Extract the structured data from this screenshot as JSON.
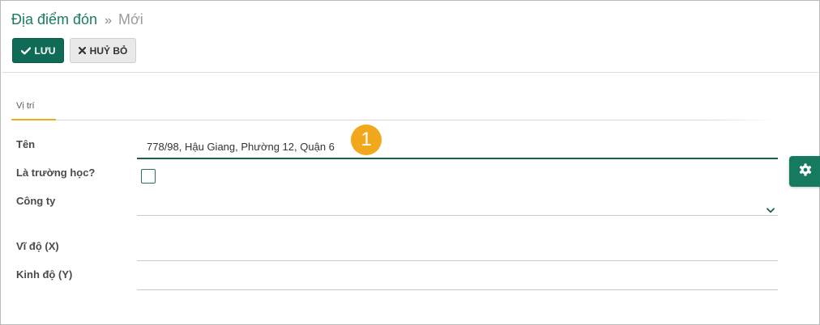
{
  "breadcrumb": {
    "parent": "Địa điểm đón",
    "separator": "»",
    "current": "Mới"
  },
  "toolbar": {
    "save_label": "LƯU",
    "cancel_label": "HUỶ BỎ"
  },
  "tabs": [
    {
      "label": "Vị trí",
      "active": true
    }
  ],
  "form": {
    "name_label": "Tên",
    "name_value": "778/98, Hậu Giang, Phường 12, Quận 6",
    "school_label": "Là trường học?",
    "school_checked": false,
    "company_label": "Công ty",
    "company_value": "",
    "lat_label": "Vĩ độ (X)",
    "lat_value": "",
    "lng_label": "Kinh độ (Y)",
    "lng_value": ""
  },
  "annotation": {
    "step": "1"
  },
  "colors": {
    "primary": "#0f6b55",
    "accent": "#f0ad18",
    "badge": "#f2a81c",
    "breadcrumb": "#1a7a62"
  },
  "icons": {
    "save": "check-icon",
    "cancel": "close-icon",
    "select": "chevron-down-icon",
    "settings": "gear-icon"
  }
}
